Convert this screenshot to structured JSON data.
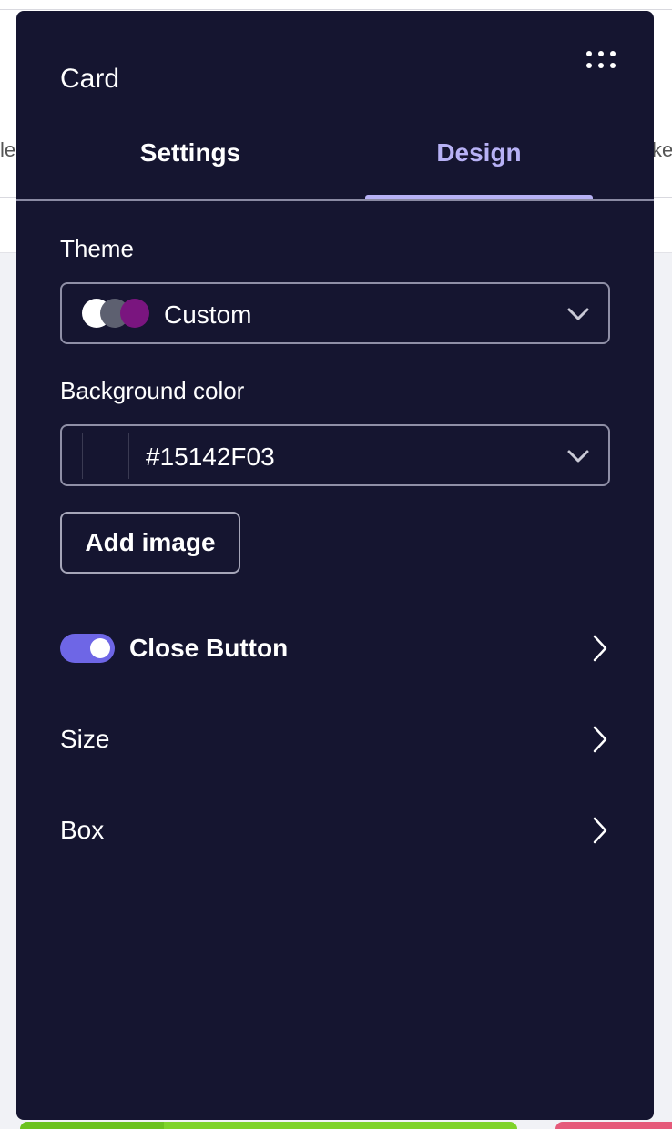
{
  "background": {
    "left_fragment": "le",
    "right_fragment": "ke"
  },
  "panel": {
    "title": "Card",
    "more_icon": "more-dots-icon"
  },
  "tabs": [
    {
      "label": "Settings",
      "active": false
    },
    {
      "label": "Design",
      "active": true
    }
  ],
  "theme": {
    "label": "Theme",
    "value": "Custom",
    "swatch_colors": [
      "#FFFFFF",
      "#5D6070",
      "#7A157F"
    ]
  },
  "background_color": {
    "label": "Background color",
    "value": "#15142F03"
  },
  "add_image_label": "Add image",
  "rows": {
    "close_button": {
      "label": "Close Button",
      "enabled": true
    },
    "size": {
      "label": "Size"
    },
    "box": {
      "label": "Box"
    }
  },
  "colors": {
    "panel_bg": "#151530",
    "accent": "#B7B1F5",
    "toggle": "#6E66E6"
  }
}
